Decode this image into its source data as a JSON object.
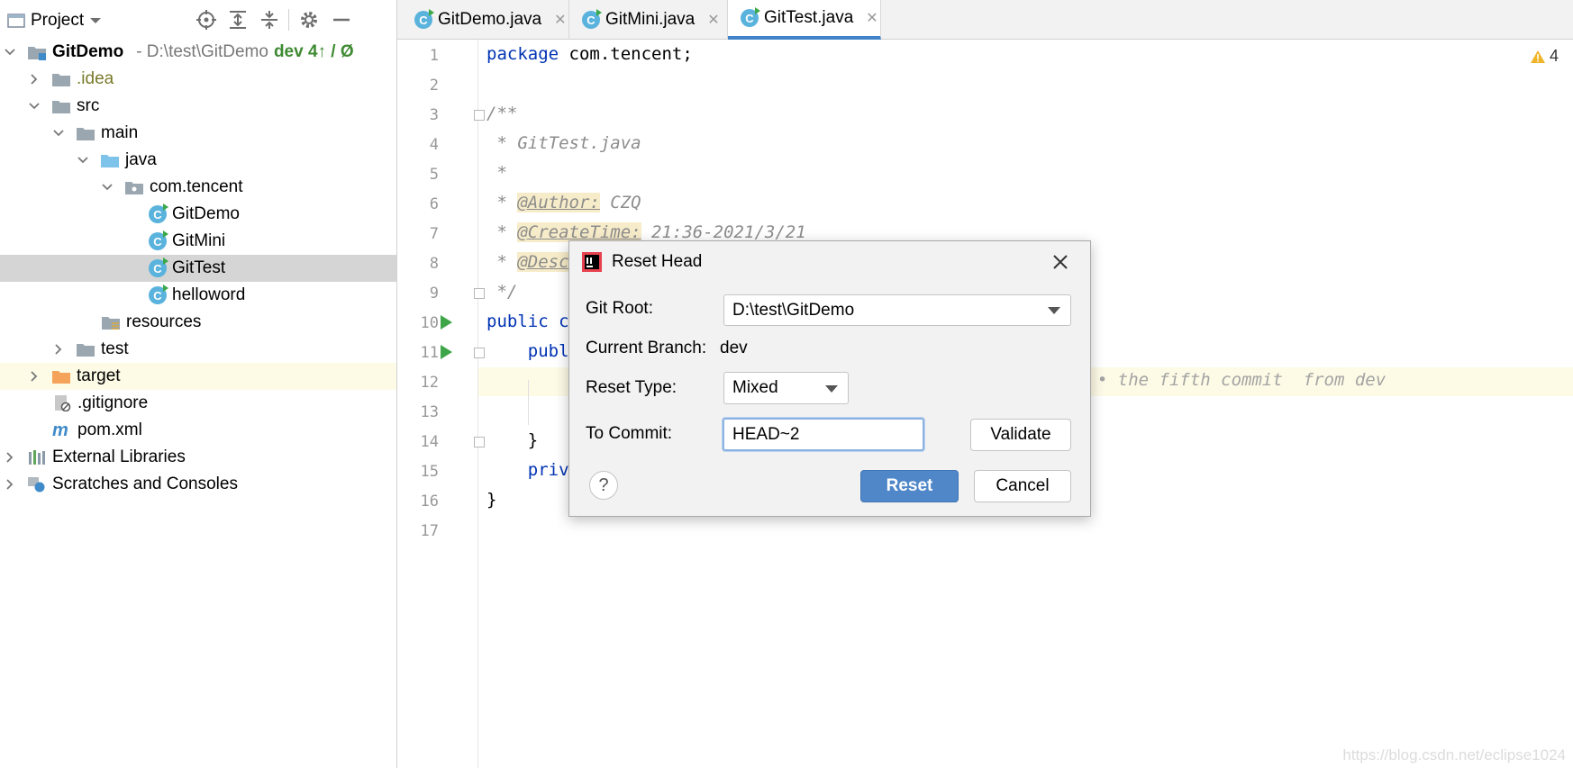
{
  "project_panel": {
    "title": "Project",
    "tree": [
      {
        "label": "GitDemo",
        "suffix": "- D:\\test\\GitDemo",
        "git": "dev 4↑ / Ø"
      },
      {
        "label": ".idea"
      },
      {
        "label": "src"
      },
      {
        "label": "main"
      },
      {
        "label": "java"
      },
      {
        "label": "com.tencent"
      },
      {
        "label": "GitDemo"
      },
      {
        "label": "GitMini"
      },
      {
        "label": "GitTest"
      },
      {
        "label": "helloword"
      },
      {
        "label": "resources"
      },
      {
        "label": "test"
      },
      {
        "label": "target"
      },
      {
        "label": ".gitignore"
      },
      {
        "label": "pom.xml"
      },
      {
        "label": "External Libraries"
      },
      {
        "label": "Scratches and Consoles"
      }
    ]
  },
  "tabs": [
    {
      "label": "GitDemo.java"
    },
    {
      "label": "GitMini.java"
    },
    {
      "label": "GitTest.java",
      "active": true
    }
  ],
  "editor": {
    "line_numbers": [
      "1",
      "2",
      "3",
      "4",
      "5",
      "6",
      "7",
      "8",
      "9",
      "10",
      "11",
      "12",
      "13",
      "14",
      "15",
      "16",
      "17"
    ],
    "lines": {
      "l1_kw": "package",
      "l1_rest": " com.tencent;",
      "l3": "/**",
      "l4": " * GitTest.java",
      "l5": " *",
      "l6_pre": " * ",
      "l6_tag": "@Author:",
      "l6_val": " CZQ",
      "l7_pre": " * ",
      "l7_tag": "@CreateTime:",
      "l7_val": " 21:36-2021/3/21",
      "l8_pre": " * ",
      "l8_tag": "@Desc",
      "l9": " */",
      "l10": "public c",
      "l11": "    publ",
      "l14": "    }",
      "l15": "    priv",
      "l16": "}"
    },
    "inlay_hint": "9 • the fifth commit  from dev",
    "warnings": "4",
    "watermark": "https://blog.csdn.net/eclipse1024"
  },
  "dialog": {
    "title": "Reset Head",
    "git_root_label": "Git Root:",
    "git_root_value": "D:\\test\\GitDemo",
    "branch_label": "Current Branch:",
    "branch_value": "dev",
    "reset_type_label": "Reset Type:",
    "reset_type_value": "Mixed",
    "commit_label": "To Commit:",
    "commit_value": "HEAD~2",
    "validate_label": "Validate",
    "reset_label": "Reset",
    "cancel_label": "Cancel",
    "help_label": "?"
  },
  "colors": {
    "accent": "#4083c9",
    "primary_button": "#4f87c9",
    "run_gutter": "#3ea648",
    "selection": "#d5d5d5"
  }
}
